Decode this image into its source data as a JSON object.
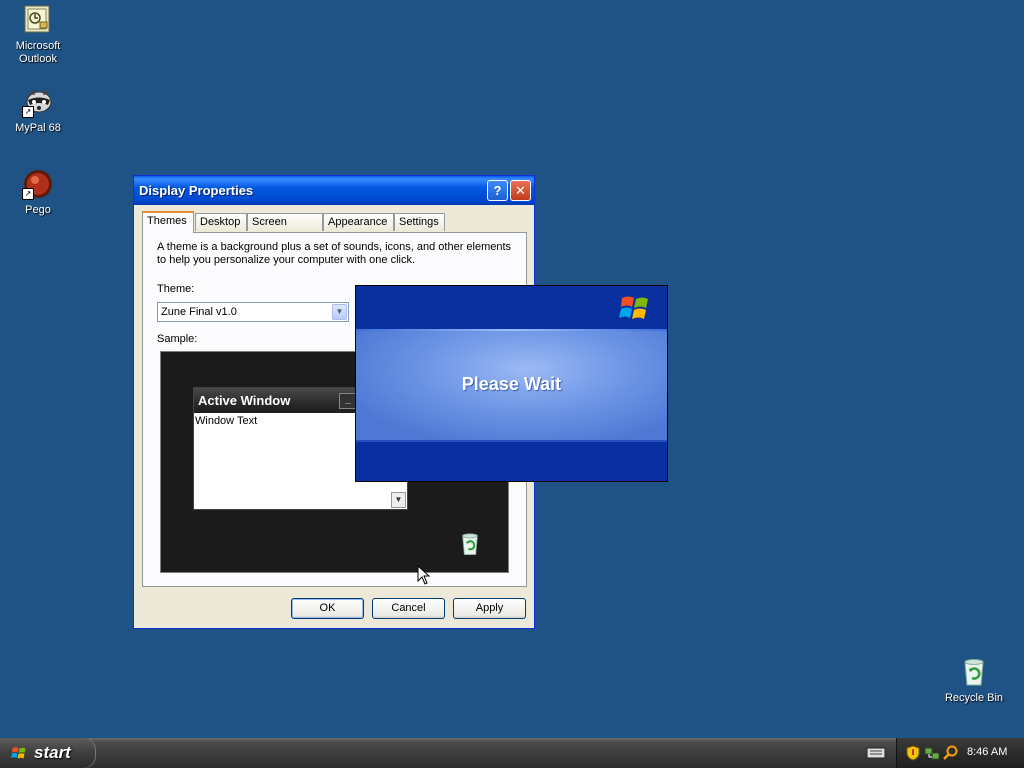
{
  "desktop": {
    "icons": [
      {
        "label": "Microsoft\nOutlook",
        "icon": "outlook-icon"
      },
      {
        "label": "MyPal 68",
        "icon": "mypal-icon"
      },
      {
        "label": "Pego",
        "icon": "pego-icon"
      },
      {
        "label": "Recycle Bin",
        "icon": "recycle-bin-icon"
      }
    ]
  },
  "dialog": {
    "title": "Display Properties",
    "help_label": "?",
    "close_label": "✕",
    "tabs": [
      {
        "label": "Themes",
        "active": true
      },
      {
        "label": "Desktop"
      },
      {
        "label": "Screen Saver"
      },
      {
        "label": "Appearance"
      },
      {
        "label": "Settings"
      }
    ],
    "description": "A theme is a background plus a set of sounds, icons, and other elements to help you personalize your computer with one click.",
    "theme_label": "Theme:",
    "theme_value": "Zune Final v1.0",
    "sample_label": "Sample:",
    "sample": {
      "window_title": "Active Window",
      "window_text": "Window Text"
    },
    "buttons": {
      "ok": "OK",
      "cancel": "Cancel",
      "apply": "Apply"
    }
  },
  "wait_window": {
    "message": "Please Wait"
  },
  "taskbar": {
    "start_label": "start",
    "clock": "8:46 AM",
    "tray_icons": [
      "keyboard-icon",
      "security-shield-icon",
      "network-icon",
      "search-icon"
    ]
  },
  "colors": {
    "desktop_bg": "#1f5385",
    "dialog_bg": "#ece9d8",
    "titlebar_blue": "#0048d0",
    "taskbar": "#3a3a3a",
    "wait_blue": "#0a2fa3"
  }
}
